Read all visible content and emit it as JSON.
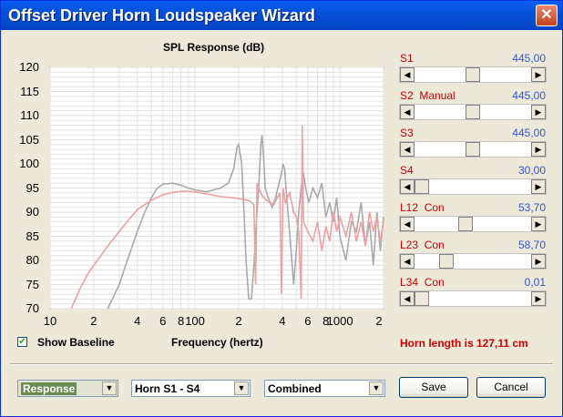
{
  "window": {
    "title": "Offset Driver Horn Loudspeaker Wizard",
    "close_glyph": "✕"
  },
  "chart_data": {
    "type": "line",
    "title": "SPL Response (dB)",
    "xlabel": "Frequency (hertz)",
    "ylabel": "",
    "x_scale": "log",
    "xlim": [
      10,
      2000
    ],
    "ylim": [
      70,
      120
    ],
    "grid": true,
    "y_ticks": [
      "120",
      "115",
      "110",
      "105",
      "100",
      "95",
      "90",
      "85",
      "80",
      "75",
      "70"
    ],
    "x_ticks": [
      {
        "label": "10",
        "value": 10
      },
      {
        "label": "2",
        "value": 20
      },
      {
        "label": "4",
        "value": 40
      },
      {
        "label": "6",
        "value": 60
      },
      {
        "label": "8",
        "value": 80
      },
      {
        "label": "100",
        "value": 100
      },
      {
        "label": "2",
        "value": 200
      },
      {
        "label": "4",
        "value": 400
      },
      {
        "label": "6",
        "value": 600
      },
      {
        "label": "8",
        "value": 800
      },
      {
        "label": "1000",
        "value": 1000
      },
      {
        "label": "2",
        "value": 2000
      }
    ],
    "series": [
      {
        "color": "#a9a9a9",
        "points": [
          [
            25,
            70
          ],
          [
            30,
            75
          ],
          [
            35,
            81
          ],
          [
            40,
            86
          ],
          [
            45,
            90
          ],
          [
            50,
            93
          ],
          [
            55,
            95
          ],
          [
            60,
            95.8
          ],
          [
            70,
            96
          ],
          [
            80,
            95.6
          ],
          [
            90,
            95
          ],
          [
            100,
            94.6
          ],
          [
            120,
            94.2
          ],
          [
            150,
            95
          ],
          [
            170,
            96
          ],
          [
            185,
            99
          ],
          [
            195,
            103.5
          ],
          [
            200,
            104
          ],
          [
            210,
            100
          ],
          [
            215,
            94
          ],
          [
            225,
            80
          ],
          [
            235,
            72
          ],
          [
            245,
            72
          ],
          [
            255,
            79
          ],
          [
            265,
            88
          ],
          [
            275,
            95
          ],
          [
            285,
            104
          ],
          [
            290,
            106
          ],
          [
            298,
            101
          ],
          [
            305,
            95
          ],
          [
            320,
            93
          ],
          [
            340,
            91
          ],
          [
            360,
            93
          ],
          [
            380,
            96
          ],
          [
            395,
            98
          ],
          [
            405,
            100
          ],
          [
            415,
            99
          ],
          [
            430,
            93
          ],
          [
            460,
            82
          ],
          [
            480,
            75
          ],
          [
            500,
            82
          ],
          [
            520,
            90
          ],
          [
            540,
            95
          ],
          [
            560,
            98
          ],
          [
            580,
            95
          ],
          [
            610,
            92
          ],
          [
            650,
            95
          ],
          [
            700,
            93
          ],
          [
            750,
            96
          ],
          [
            800,
            89
          ],
          [
            850,
            92
          ],
          [
            900,
            88
          ],
          [
            950,
            93
          ],
          [
            1000,
            85
          ],
          [
            1100,
            80
          ],
          [
            1200,
            88
          ],
          [
            1300,
            86
          ],
          [
            1400,
            92
          ],
          [
            1500,
            83
          ],
          [
            1600,
            88
          ],
          [
            1700,
            79
          ],
          [
            1800,
            90
          ],
          [
            1900,
            82
          ],
          [
            2000,
            89
          ]
        ]
      },
      {
        "color": "#f0a0a0",
        "points": [
          [
            14,
            70
          ],
          [
            16,
            74
          ],
          [
            18,
            77
          ],
          [
            20,
            79
          ],
          [
            25,
            83
          ],
          [
            30,
            86
          ],
          [
            35,
            88.5
          ],
          [
            40,
            90.5
          ],
          [
            50,
            92.5
          ],
          [
            60,
            93.6
          ],
          [
            70,
            94.1
          ],
          [
            80,
            94.3
          ],
          [
            90,
            94.3
          ],
          [
            100,
            94.2
          ],
          [
            120,
            93.8
          ],
          [
            150,
            93.2
          ],
          [
            180,
            93
          ],
          [
            200,
            92.8
          ],
          [
            220,
            92.6
          ],
          [
            240,
            92.3
          ],
          [
            255,
            91.5
          ],
          [
            262,
            75
          ],
          [
            268,
            96
          ],
          [
            275,
            95
          ],
          [
            290,
            93.5
          ],
          [
            310,
            92.5
          ],
          [
            330,
            92
          ],
          [
            350,
            91.5
          ],
          [
            370,
            93
          ],
          [
            385,
            94
          ],
          [
            395,
            73
          ],
          [
            405,
            95
          ],
          [
            420,
            92
          ],
          [
            450,
            94
          ],
          [
            480,
            90
          ],
          [
            500,
            89
          ],
          [
            520,
            86
          ],
          [
            540,
            72
          ],
          [
            550,
            108
          ],
          [
            560,
            88
          ],
          [
            600,
            86
          ],
          [
            650,
            84
          ],
          [
            700,
            88
          ],
          [
            750,
            82
          ],
          [
            800,
            87
          ],
          [
            850,
            84
          ],
          [
            900,
            90
          ],
          [
            950,
            86
          ],
          [
            1000,
            89
          ],
          [
            1100,
            85
          ],
          [
            1200,
            90
          ],
          [
            1300,
            84
          ],
          [
            1400,
            88
          ],
          [
            1500,
            83
          ],
          [
            1600,
            90
          ],
          [
            1700,
            86
          ],
          [
            1800,
            89
          ],
          [
            1900,
            84
          ],
          [
            2000,
            88
          ]
        ]
      }
    ]
  },
  "sliders": [
    {
      "label": "S1",
      "value": "445,00",
      "pos": 0.5
    },
    {
      "label": "S2  Manual",
      "value": "445,00",
      "pos": 0.5
    },
    {
      "label": "S3",
      "value": "445,00",
      "pos": 0.5
    },
    {
      "label": "S4",
      "value": "30,00",
      "pos": 0.0
    },
    {
      "label": "L12  Con",
      "value": "53,70",
      "pos": 0.43
    },
    {
      "label": "L23  Con",
      "value": "58,70",
      "pos": 0.24
    },
    {
      "label": "L34  Con",
      "value": "0,01",
      "pos": 0.0
    }
  ],
  "options": {
    "show_baseline_label": "Show Baseline",
    "show_baseline_checked": true,
    "check_glyph": "✔"
  },
  "horn_length": "Horn length is 127,11 cm",
  "bottom": {
    "view_select": "Response",
    "horn_select": "Horn S1 - S4",
    "mode_select": "Combined",
    "save_label": "Save",
    "cancel_label": "Cancel",
    "arrow_down": "▼",
    "arrow_left": "◀",
    "arrow_right": "▶"
  }
}
